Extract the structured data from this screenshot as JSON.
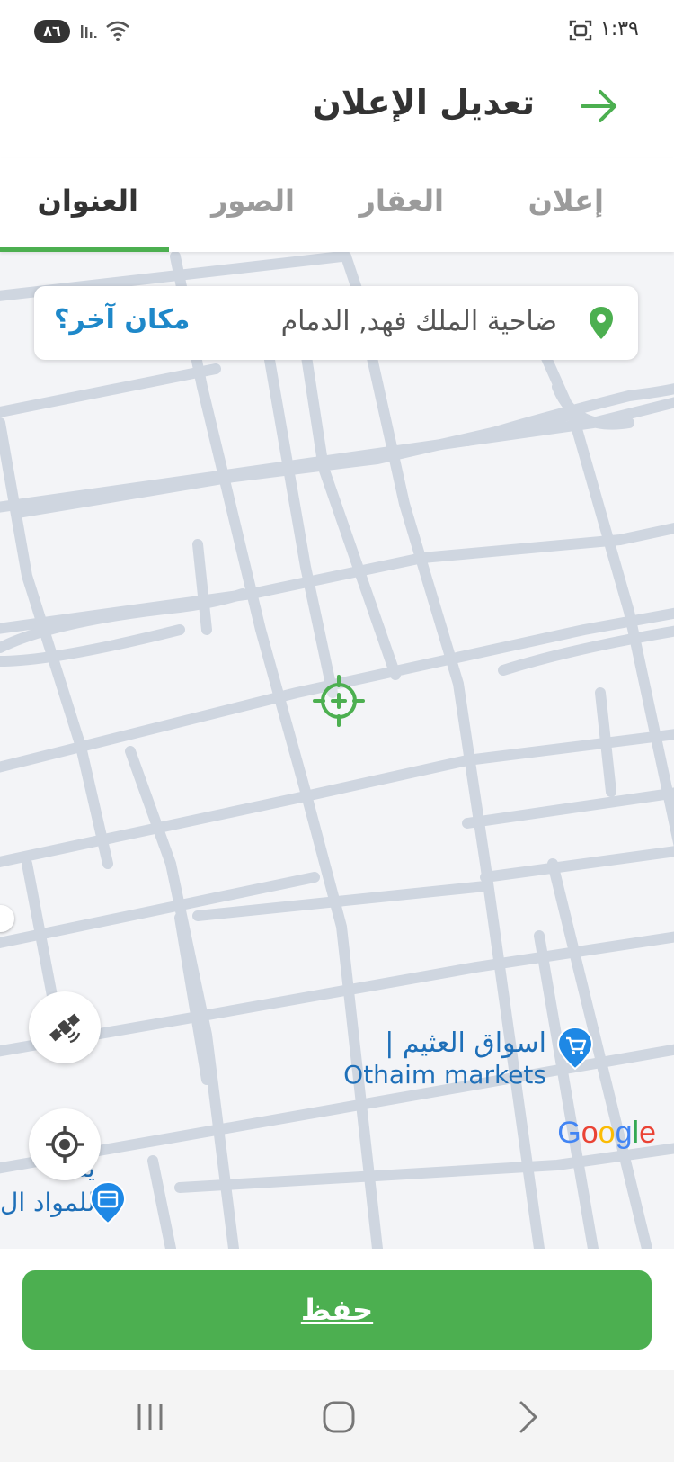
{
  "status_bar": {
    "battery": "٨٦",
    "time": "١:٣٩"
  },
  "header": {
    "title": "تعديل الإعلان",
    "back_icon": "arrow-right-icon"
  },
  "tabs": [
    {
      "label": "إعلان",
      "active": false
    },
    {
      "label": "العقار",
      "active": false
    },
    {
      "label": "الصور",
      "active": false
    },
    {
      "label": "العنوان",
      "active": true
    }
  ],
  "address_bar": {
    "address": "ضاحية الملك فهد, الدمام",
    "other_place": "مكان آخر؟",
    "pin_icon": "location-pin-icon"
  },
  "map": {
    "poi": {
      "name_ar": "اسواق العثيم |",
      "name_en": "Othaim markets",
      "icon": "shopping-cart-icon"
    },
    "poi_partial": {
      "line1": "ينات",
      "line2": "للمواد ال",
      "icon": "store-icon"
    },
    "attribution": "Google",
    "colors": {
      "background": "#f3f4f7",
      "road": "#cfd6e0",
      "accent": "#4caf50",
      "poi": "#1e88e5"
    }
  },
  "save_button": {
    "label": "حفظ"
  },
  "nav_bar": {
    "recent_icon": "recent-apps-icon",
    "home_icon": "home-icon",
    "back_icon": "back-chevron-icon"
  }
}
